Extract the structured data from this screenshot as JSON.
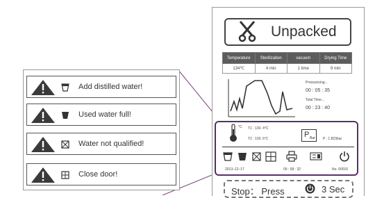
{
  "alerts": [
    {
      "icon": "cup-icon",
      "label": "Add distilled water!"
    },
    {
      "icon": "bucket-full-icon",
      "label": "Used water full!"
    },
    {
      "icon": "water-x-icon",
      "label": "Water not qualified!"
    },
    {
      "icon": "door-icon",
      "label": "Close door!"
    }
  ],
  "device": {
    "title": "Unpacked",
    "table": {
      "headers": [
        "Temperature",
        "Sterilization",
        "vacuum",
        "Drying Time"
      ],
      "values": [
        "134℃",
        "4 min",
        "1 time",
        "9 min"
      ]
    },
    "timer": {
      "pressurizing_label": "Pressurizing...",
      "pressurizing_value": "00 : 05 : 35",
      "total_label": "Total Time...",
      "total_value": "00 : 23 : 40"
    },
    "status": {
      "temp_unit": "°C",
      "t1": "T1 : 130. 4°C",
      "t2": "T2 : 130. 6°C",
      "pressure_letter": "P",
      "pressure_sub": "Bar",
      "pressure_value": "P : 1.823bar",
      "date": "2013–12–17",
      "time": "09 : 58 : 32",
      "number": "No. 00016"
    },
    "stop": {
      "label": "Stop： Press",
      "duration": "3 Sec"
    }
  },
  "colors": {
    "purple_border": "#5b2c6b",
    "table_header": "#5c5c5c"
  }
}
